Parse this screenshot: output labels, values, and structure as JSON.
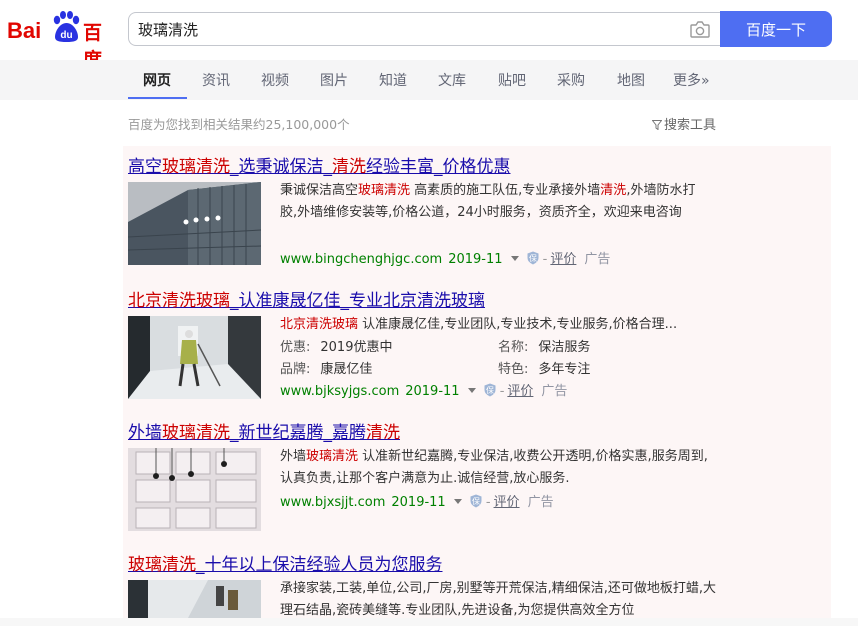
{
  "logo": {
    "text_left": "Bai",
    "text_paw": "du",
    "text_cn": "百度"
  },
  "search": {
    "value": "玻璃清洗",
    "button_label": "百度一下"
  },
  "nav": {
    "tabs": [
      "网页",
      "资讯",
      "视频",
      "图片",
      "知道",
      "文库",
      "贴吧",
      "采购",
      "地图",
      "更多»"
    ],
    "active": "网页"
  },
  "stats": "百度为您找到相关结果约25,100,000个",
  "tools_label": "搜索工具",
  "colors": {
    "brand_red": "#e10601",
    "accent_blue": "#4e6ef2",
    "link": "#1a0dab",
    "highlight": "#c00",
    "url_green": "#008000"
  },
  "results": [
    {
      "title_parts": [
        "高空",
        "玻璃清洗",
        "_选秉诚保洁_",
        "清洗",
        "经验丰富_价格优惠"
      ],
      "desc_parts": [
        "秉诚保洁高空",
        "玻璃清洗",
        " 高素质的施工队伍,专业承接外墙",
        "清洗",
        ",外墙防水打胶,外墙维修安装等,价格公道，24小时服务，资质齐全，欢迎来电咨询"
      ],
      "url": "www.bingchenghjgc.com",
      "date": "2019-11",
      "rate": "评价",
      "ad": "广告"
    },
    {
      "title_parts": [
        "北京清洗玻璃",
        "_认准康晟亿佳_专业北京清洗玻璃"
      ],
      "desc_parts": [
        "北京清洗玻璃",
        " 认准康晟亿佳,专业团队,专业技术,专业服务,价格合理..."
      ],
      "fields": [
        {
          "k": "优惠:",
          "v": "2019优惠中"
        },
        {
          "k": "名称:",
          "v": "保洁服务"
        },
        {
          "k": "品牌:",
          "v": "康晟亿佳"
        },
        {
          "k": "特色:",
          "v": "多年专注"
        }
      ],
      "url": "www.bjksyjgs.com",
      "date": "2019-11",
      "rate": "评价",
      "ad": "广告"
    },
    {
      "title_parts": [
        "外墙",
        "玻璃清洗",
        "_新世纪嘉腾_嘉腾",
        "清洗"
      ],
      "desc_parts": [
        "外墙",
        "玻璃清洗",
        " 认准新世纪嘉腾,专业保洁,收费公开透明,价格实惠,服务周到,认真负责,让那个客户满意为止.诚信经营,放心服务."
      ],
      "url": "www.bjxsjjt.com",
      "date": "2019-11",
      "rate": "评价",
      "ad": "广告"
    },
    {
      "title_parts": [
        "玻璃清洗",
        "_十年以上保洁经验人员为您服务"
      ],
      "desc_parts": [
        "承接家装,工装,单位,公司,厂房,别墅等开荒保洁,精细保洁,还可做地板打蜡,大理石结晶,瓷砖美缝等.专业团队,先进设备,为您提供高效全方位"
      ]
    }
  ]
}
